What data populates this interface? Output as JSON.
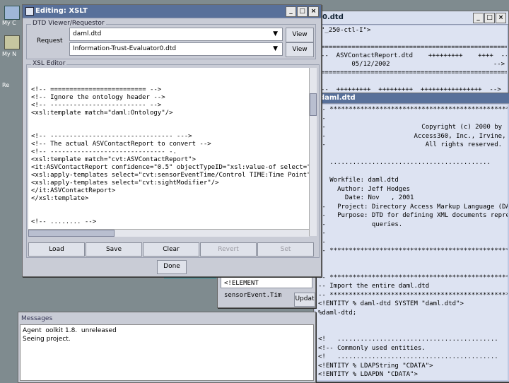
{
  "desktop": {
    "icons": [
      "My C",
      "My N",
      "Re"
    ]
  },
  "dtd_window": {
    "title": "0.dtd",
    "lines": [
      "\"_250-ctl-I\">",
      "",
      "========================================================-->",
      "--  ASVContactReport.dtd    +++++++++    ++++  -->",
      "        05/12/2002                           -->",
      "========================================================-->",
      "",
      "--  +++++++++  +++++++++  ++++++++++++++++  -->"
    ]
  },
  "daml_window": {
    "title": "daml.dtd",
    "lines": [
      "-- ***********************************************",
      "--",
      "--                         Copyright (c) 2000 by",
      "--                       Access360, Inc., Irvine, CA",
      "--                          All rights reserved.",
      "",
      "   ..........................................",
      "",
      "   Workfile: daml.dtd",
      "     Author: Jeff Hodges",
      "       Date: Nov   , 2001",
      "--   Project: Directory Access Markup Language (DAML)",
      "--   Purpose: DTD for defining XML documents representing",
      "--            queries.",
      "--",
      "--",
      "-- ***********************************************",
      "",
      "",
      "-- ***********************************************",
      "-- Import the entire daml.dtd",
      "-- ***********************************************",
      "<!ENTITY % daml-dtd SYSTEM \"daml.dtd\">",
      "%daml-dtd;",
      "",
      "",
      "<!   ..........................................",
      "<!-- Commonly used entities.",
      "<!   ..........................................",
      "<!ENTITY % LDAPString \"CDATA\">",
      "<!ENTITY % LDAPDN \"CDATA\">"
    ]
  },
  "middle_fragment": {
    "element_line": "<!ELEMENT sensorEvent.Tim",
    "update_label": "Updat"
  },
  "messages": {
    "title": "Messages",
    "lines": [
      "Agent  oolkit 1.8.  unreleased",
      "Seeing project."
    ]
  },
  "xslt_window": {
    "title": "Editing: XSLT",
    "dtd_group_label": "DTD Viewer/Requestor",
    "request_label": "Request",
    "rows": [
      {
        "select": "daml.dtd",
        "view": "View"
      },
      {
        "select": "Information-Trust-Evaluator0.dtd",
        "view": "View"
      }
    ],
    "editor_label": "XSL Editor",
    "code_lines": [
      "<!-- ========================= -->",
      "<!-- Ignore the ontology header -->",
      "<!-- ------------------------- -->",
      "<xsl:template match=\"daml:Ontology\"/>",
      "",
      "",
      "<!-- -------------------------------- --->",
      "<!-- The actual ASVContactReport to convert -->",
      "<!-- ------------------------------ -.",
      "<xsl:template match=\"cvt:ASVContactReport\">",
      "<it:ASVContactReport confidence=\"0.5\" objectTypeID=\"xsl:value-of select=\"sourc",
      "<xsl:apply-templates select=\"cvt:sensorEventTime/Control TIME:Time Point\"/>",
      "<xsl:apply-templates select=\"cvt:sightModifier\"/>",
      "</it:ASVContactReport>",
      "</xsl:template>",
      "",
      "",
      "<!-- ........ -->"
    ],
    "buttons": {
      "load": "Load",
      "save": "Save",
      "clear": "Clear",
      "revert": "Revert",
      "set": "Set"
    },
    "done": "Done"
  }
}
